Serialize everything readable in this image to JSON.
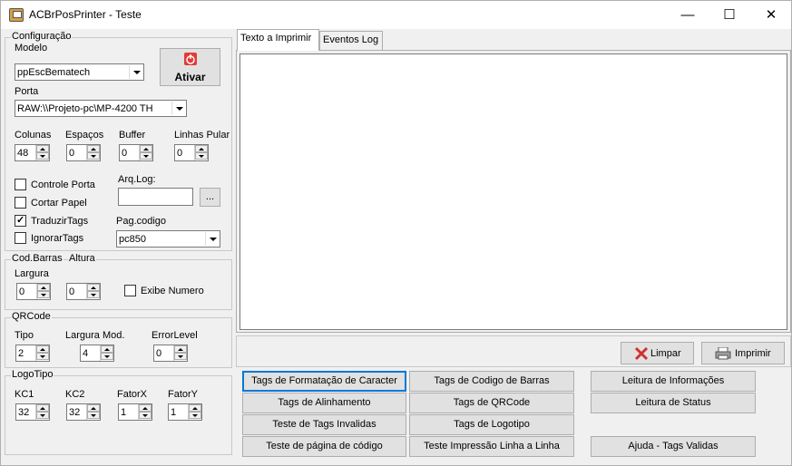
{
  "window": {
    "title": "ACBrPosPrinter - Teste",
    "minimize_glyph": "—",
    "maximize_glyph": "☐",
    "close_glyph": "✕"
  },
  "config": {
    "group_label": "Configuração",
    "modelo_label": "Modelo",
    "modelo_value": "ppEscBematech",
    "ativar_label": "Ativar",
    "porta_label": "Porta",
    "porta_value": "RAW:\\\\Projeto-pc\\MP-4200 TH",
    "colunas_label": "Colunas",
    "colunas_value": "48",
    "espacos_label": "Espaços",
    "espacos_value": "0",
    "buffer_label": "Buffer",
    "buffer_value": "0",
    "linhas_pular_label": "Linhas Pular",
    "linhas_pular_value": "0",
    "controle_porta_label": "Controle Porta",
    "controle_porta_checked": false,
    "cortar_papel_label": "Cortar Papel",
    "cortar_papel_checked": false,
    "traduzir_tags_label": "TraduzirTags",
    "traduzir_tags_checked": true,
    "ignorar_tags_label": "IgnorarTags",
    "ignorar_tags_checked": false,
    "arq_log_label": "Arq.Log:",
    "arq_log_value": "",
    "browse_label": "...",
    "pag_codigo_label": "Pag.codigo",
    "pag_codigo_value": "pc850"
  },
  "barcode": {
    "group_label": "Cod.Barras",
    "largura_label": "Largura",
    "largura_value": "0",
    "altura_label": "Altura",
    "altura_value": "0",
    "exibe_numero_label": "Exibe Numero",
    "exibe_numero_checked": false
  },
  "qrcode": {
    "group_label": "QRCode",
    "tipo_label": "Tipo",
    "tipo_value": "2",
    "largura_mod_label": "Largura Mod.",
    "largura_mod_value": "4",
    "error_level_label": "ErrorLevel",
    "error_level_value": "0"
  },
  "logotipo": {
    "group_label": "LogoTipo",
    "kc1_label": "KC1",
    "kc1_value": "32",
    "kc2_label": "KC2",
    "kc2_value": "32",
    "fatorx_label": "FatorX",
    "fatorx_value": "1",
    "fatory_label": "FatorY",
    "fatory_value": "1"
  },
  "tabs": [
    {
      "label": "Texto a Imprimir",
      "active": true
    },
    {
      "label": "Eventos Log",
      "active": false
    }
  ],
  "memo_text": "",
  "actions": {
    "limpar_label": "Limpar",
    "imprimir_label": "Imprimir"
  },
  "tag_buttons": {
    "col1": [
      "Tags de Formatação de Caracter",
      "Tags de Alinhamento",
      "Teste de Tags Invalidas",
      "Teste de página de código"
    ],
    "col2": [
      "Tags de Codigo de Barras",
      "Tags de QRCode",
      "Tags de Logotipo",
      "Teste Impressão Linha a Linha"
    ],
    "col3": [
      "Leitura de Informações",
      "Leitura de Status",
      "Ajuda - Tags Validas"
    ]
  },
  "colors": {
    "focus_border": "#0078d7",
    "ativar_icon": "#e53935",
    "limpar_icon": "#d32f2f"
  }
}
